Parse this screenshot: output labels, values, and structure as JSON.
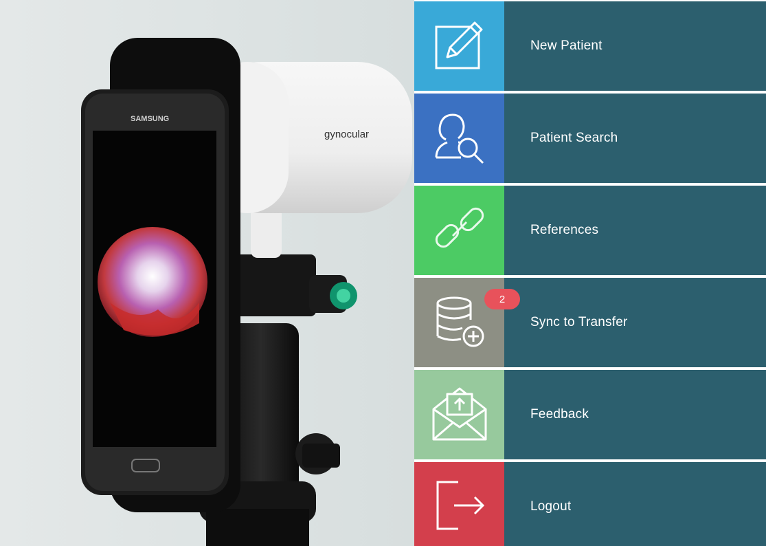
{
  "photo": {
    "phone_brand": "SAMSUNG",
    "device_brand": "gynocular"
  },
  "menu": {
    "items": [
      {
        "label": "New Patient",
        "icon": "edit-icon",
        "color": "#39a9d8"
      },
      {
        "label": "Patient Search",
        "icon": "user-search-icon",
        "color": "#3b71c2"
      },
      {
        "label": "References",
        "icon": "link-icon",
        "color": "#4ccb64"
      },
      {
        "label": "Sync to Transfer",
        "icon": "database-add-icon",
        "color": "#8d8f84",
        "badge": "2"
      },
      {
        "label": "Feedback",
        "icon": "mail-upload-icon",
        "color": "#97c99d"
      },
      {
        "label": "Logout",
        "icon": "logout-icon",
        "color": "#d33f4c"
      }
    ]
  }
}
